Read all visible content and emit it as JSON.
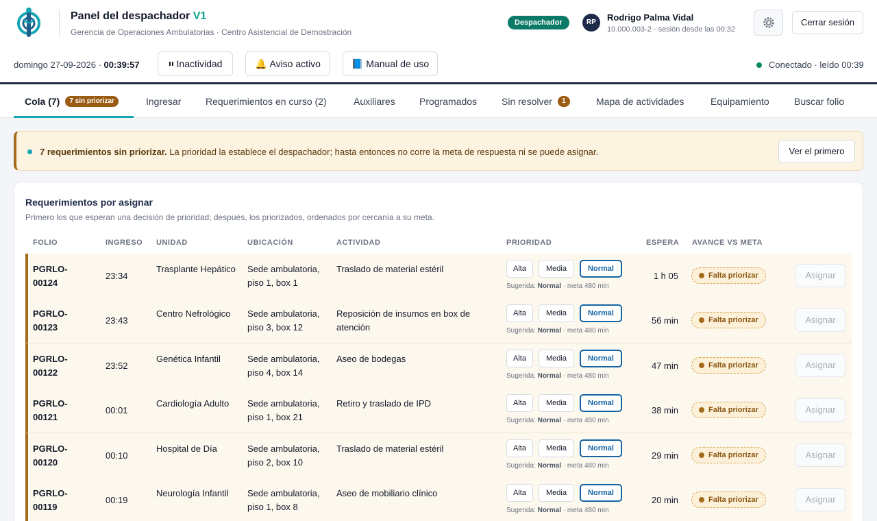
{
  "header": {
    "title": "Panel del despachador",
    "version": "V1",
    "subtitle": "Gerencia de Operaciones Ambulatorias · Centro Asistencial de Demostración",
    "role": "Despachador",
    "avatar_initials": "RP",
    "user_name": "Rodrigo Palma Vidal",
    "user_meta": "10.000.003-2 · sesión desde las 00:32",
    "logout_label": "Cerrar sesión",
    "gear_icon": "gear-icon"
  },
  "toolbar": {
    "date": "domingo 27-09-2026 ·",
    "time": "00:39:57",
    "inactivity_label": "Inactividad",
    "notice_label": "Aviso activo",
    "manual_label": "Manual de uso",
    "connection": "Conectado · leído 00:39"
  },
  "tabs": {
    "queue": "Cola (7)",
    "queue_badge": "7 sin priorizar",
    "enter": "Ingresar",
    "in_progress": "Requerimientos en curso (2)",
    "auxiliaries": "Auxiliares",
    "scheduled": "Programados",
    "unresolved": "Sin resolver",
    "unresolved_count": "1",
    "activity_map": "Mapa de actividades",
    "equipment": "Equipamiento",
    "search_folio": "Buscar folio"
  },
  "alert": {
    "bold": "7 requerimientos sin priorizar.",
    "text": " La prioridad la establece el despachador; hasta entonces no corre la meta de respuesta ni se puede asignar.",
    "button": "Ver el primero"
  },
  "card": {
    "title": "Requerimientos por asignar",
    "subtitle": "Primero los que esperan una decisión de prioridad; después, los priorizados, ordenados por cercanía a su meta.",
    "columns": {
      "folio": "FOLIO",
      "ingreso": "INGRESO",
      "unidad": "UNIDAD",
      "ubicacion": "UBICACIÓN",
      "actividad": "ACTIVIDAD",
      "prioridad": "PRIORIDAD",
      "espera": "ESPERA",
      "avance": "AVANCE VS META"
    },
    "priority_labels": {
      "alta": "Alta",
      "media": "Media",
      "normal": "Normal"
    },
    "suggested_prefix": "Sugerida: ",
    "suggested_value": "Normal",
    "suggested_suffix": " · meta 480 min",
    "status_label": "Falta priorizar",
    "assign_label": "Asignar"
  },
  "rows": [
    {
      "folio": "PGRLO-00124",
      "ingreso": "23:34",
      "unidad": "Trasplante Hepático",
      "ubicacion": "Sede ambulatoria, piso 1, box 1",
      "actividad": "Traslado de material estéril",
      "espera": "1 h 05"
    },
    {
      "folio": "PGRLO-00123",
      "ingreso": "23:43",
      "unidad": "Centro Nefrológico",
      "ubicacion": "Sede ambulatoria, piso 3, box 12",
      "actividad": "Reposición de insumos en box de atención",
      "espera": "56 min"
    },
    {
      "folio": "PGRLO-00122",
      "ingreso": "23:52",
      "unidad": "Genética Infantil",
      "ubicacion": "Sede ambulatoria, piso 4, box 14",
      "actividad": "Aseo de bodegas",
      "espera": "47 min"
    },
    {
      "folio": "PGRLO-00121",
      "ingreso": "00:01",
      "unidad": "Cardiología Adulto",
      "ubicacion": "Sede ambulatoria, piso 1, box 21",
      "actividad": "Retiro y traslado de IPD",
      "espera": "38 min"
    },
    {
      "folio": "PGRLO-00120",
      "ingreso": "00:10",
      "unidad": "Hospital de Día",
      "ubicacion": "Sede ambulatoria, piso 2, box 10",
      "actividad": "Traslado de material estéril",
      "espera": "29 min"
    },
    {
      "folio": "PGRLO-00119",
      "ingreso": "00:19",
      "unidad": "Neurología Infantil",
      "ubicacion": "Sede ambulatoria, piso 1, box 8",
      "actividad": "Aseo de mobiliario clínico",
      "espera": "20 min"
    }
  ],
  "colors": {
    "accent": "#14a4b4",
    "brand_dark": "#1d2b45",
    "warning": "#a46b1c",
    "selected_priority": "#1664a3",
    "role_badge": "#0b7a66"
  }
}
